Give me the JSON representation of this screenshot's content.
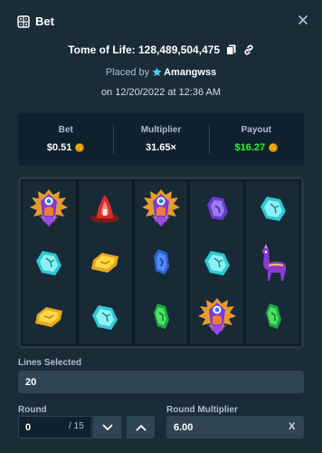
{
  "header": {
    "title": "Bet",
    "icon": "bet-icon",
    "close_icon": "close-icon"
  },
  "game": {
    "title_prefix": "Tome of Life: ",
    "bet_id": "128,489,504,475"
  },
  "placed": {
    "prefix": "Placed by",
    "user": "Amangwss",
    "date": "on 12/20/2022 at 12:36 AM"
  },
  "stats": {
    "bet": {
      "label": "Bet",
      "value": "$0.51"
    },
    "multiplier": {
      "label": "Multiplier",
      "value": "31.65×"
    },
    "payout": {
      "label": "Payout",
      "value": "$16.27"
    }
  },
  "board": {
    "reels": [
      [
        "sorceress",
        "aqua-gem",
        "gold-gem"
      ],
      [
        "red-helm",
        "gold-gem",
        "aqua-gem"
      ],
      [
        "sorceress",
        "blue-gem",
        "green-gem"
      ],
      [
        "purple-gem",
        "aqua-gem",
        "sorceress"
      ],
      [
        "aqua-gem",
        "llama",
        "green-gem"
      ]
    ]
  },
  "lines": {
    "label": "Lines Selected",
    "value": "20"
  },
  "round": {
    "label": "Round",
    "value": "0",
    "max": "/ 15"
  },
  "round_multiplier": {
    "label": "Round Multiplier",
    "value": "6.00",
    "suffix": "X"
  },
  "colors": {
    "bg": "#1a2c38",
    "panel": "#0f212e",
    "payout_green": "#1fff20",
    "input": "#2f4553"
  }
}
